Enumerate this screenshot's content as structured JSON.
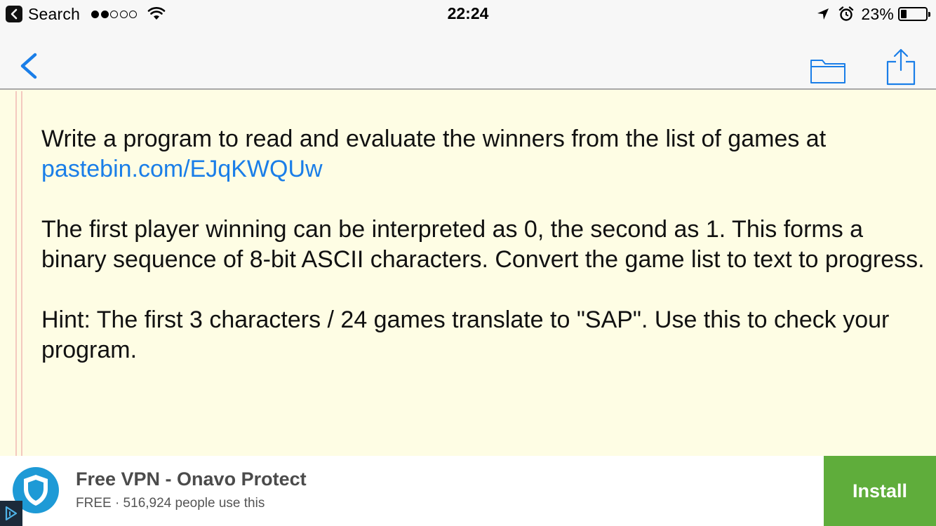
{
  "status_bar": {
    "back_app": "Search",
    "time": "22:24",
    "battery_percent": "23%",
    "signal_bars_filled": 2,
    "signal_bars_total": 5,
    "battery_level": 0.23
  },
  "nav": {
    "back_icon": "chevron-left-icon",
    "folder_icon": "folder-icon",
    "share_icon": "share-icon",
    "accent_color": "#1a7ee8"
  },
  "content": {
    "para1_text": "Write a program to read and evaluate the winners from the list of games at",
    "para1_link": "pastebin.com/EJqKWQUw",
    "para2_text": "The first player winning can be interpreted as 0, the second as 1. This forms a binary sequence of 8-bit ASCII characters. Convert the game list to text to progress.",
    "para3_text": "Hint: The first 3 characters / 24 games translate to \"SAP\". Use this to check your program."
  },
  "ad": {
    "title": "Free VPN - Onavo Protect",
    "subtitle": "FREE · 516,924 people use this",
    "install_label": "Install",
    "install_color": "#5fad3b",
    "app_icon": "shield-icon",
    "adchoices_icon": "adchoices-icon"
  }
}
